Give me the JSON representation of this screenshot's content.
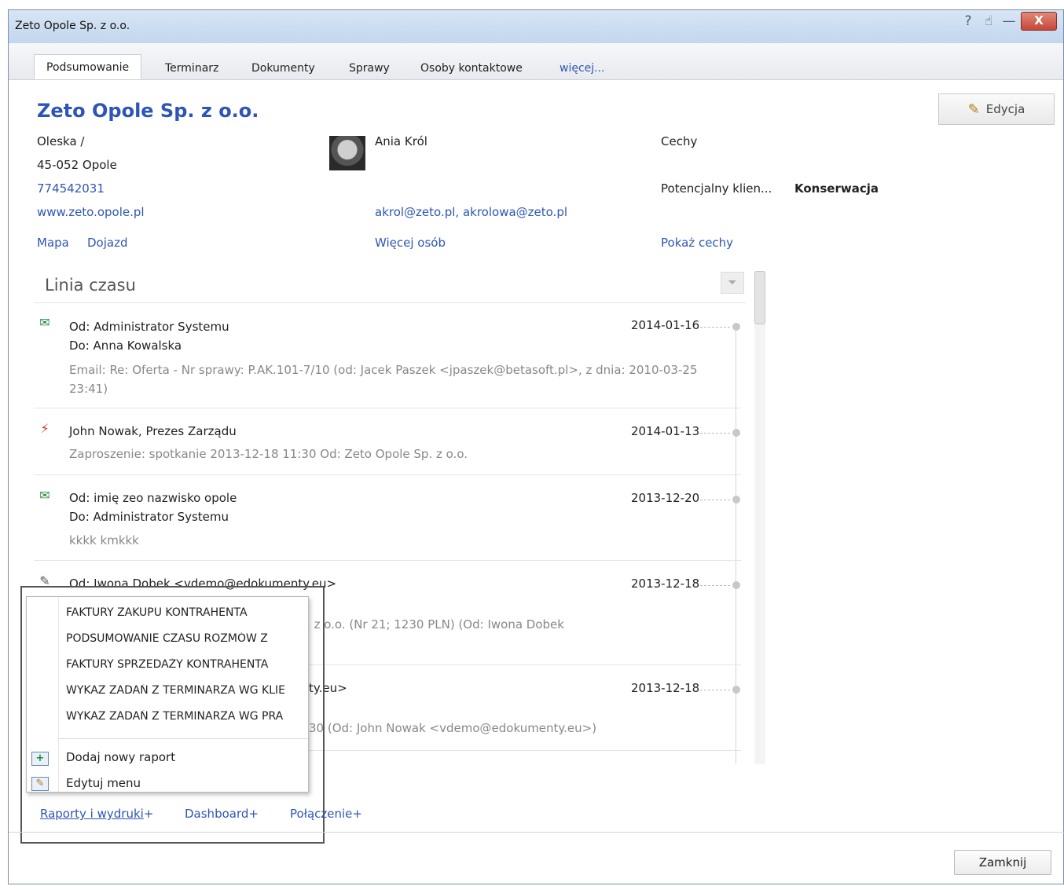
{
  "window": {
    "title": "Zeto Opole Sp. z o.o.",
    "help_glyph": "?",
    "like_glyph": "☝",
    "minimize_glyph": "—",
    "close_glyph": "X"
  },
  "tabs": [
    {
      "label": "Podsumowanie",
      "active": true
    },
    {
      "label": "Terminarz"
    },
    {
      "label": "Dokumenty"
    },
    {
      "label": "Sprawy"
    },
    {
      "label": "Osoby kontaktowe"
    },
    {
      "label": "więcej..."
    }
  ],
  "company": {
    "name": "Zeto Opole Sp. z o.o.",
    "street": "Oleska /",
    "postal_city": "45-052 Opole",
    "phone": "774542031",
    "website": "www.zeto.opole.pl",
    "map_link": "Mapa",
    "directions_link": "Dojazd"
  },
  "contact": {
    "name": "Ania Król",
    "emails": "akrol@zeto.pl, akrolowa@zeto.pl",
    "more_people_link": "Więcej osób"
  },
  "features": {
    "heading": "Cechy",
    "label": "Potencjalny klien...",
    "value": "Konserwacja",
    "show_link": "Pokaż cechy"
  },
  "edit_button": {
    "label": "Edycja",
    "icon": "pencil-icon"
  },
  "timeline": {
    "heading": "Linia czasu",
    "entries": [
      {
        "icon": "mail-check-icon",
        "line1": "Od: Administrator Systemu",
        "line2": "Do: Anna Kowalska",
        "desc": "Email: Re: Oferta - Nr sprawy: P.AK.101-7/10 (od: Jacek Paszek <jpaszek@betasoft.pl>, z dnia: 2010-03-25 23:41)",
        "date": "2014-01-16"
      },
      {
        "icon": "meeting-icon",
        "line1": "John Nowak, Prezes Zarządu",
        "desc": "Zaproszenie: spotkanie 2013-12-18 11:30 Od: Zeto Opole Sp. z o.o.",
        "date": "2014-01-13"
      },
      {
        "icon": "mail-check-icon",
        "line1": "Od: imię zeo nazwisko opole",
        "line2": "Do: Administrator Systemu",
        "desc": "kkkk kmkkk",
        "date": "2013-12-20"
      },
      {
        "icon": "document-icon",
        "line1": "Od: Iwona Dobek <vdemo@edokumenty.eu>",
        "desc_visible": "Sp. z o.o. (Nr 21; 1230 PLN) (Od: Iwona Dobek",
        "date": "2013-12-18"
      },
      {
        "icon": "document-icon",
        "line1_visible": "ty.eu>",
        "desc_visible": "30 (Od: John Nowak <vdemo@edokumenty.eu>)",
        "date": "2013-12-18"
      }
    ]
  },
  "reports_menu": {
    "items": [
      "FAKTURY ZAKUPU KONTRAHENTA",
      "PODSUMOWANIE CZASU ROZMÓW Z",
      "FAKTURY SPRZEDAŻY KONTRAHENTA",
      "WYKAZ ZADAŃ Z TERMINARZA WG KLIE",
      "WYKAZ ZADAŃ Z TERMINARZA WG PRA"
    ],
    "add_label": "Dodaj nowy raport",
    "edit_label": "Edytuj menu"
  },
  "footer": {
    "reports_link": "Raporty i wydruki",
    "dashboard_link": "Dashboard",
    "connection_link": "Połączenie",
    "close_button": "Zamknij"
  }
}
